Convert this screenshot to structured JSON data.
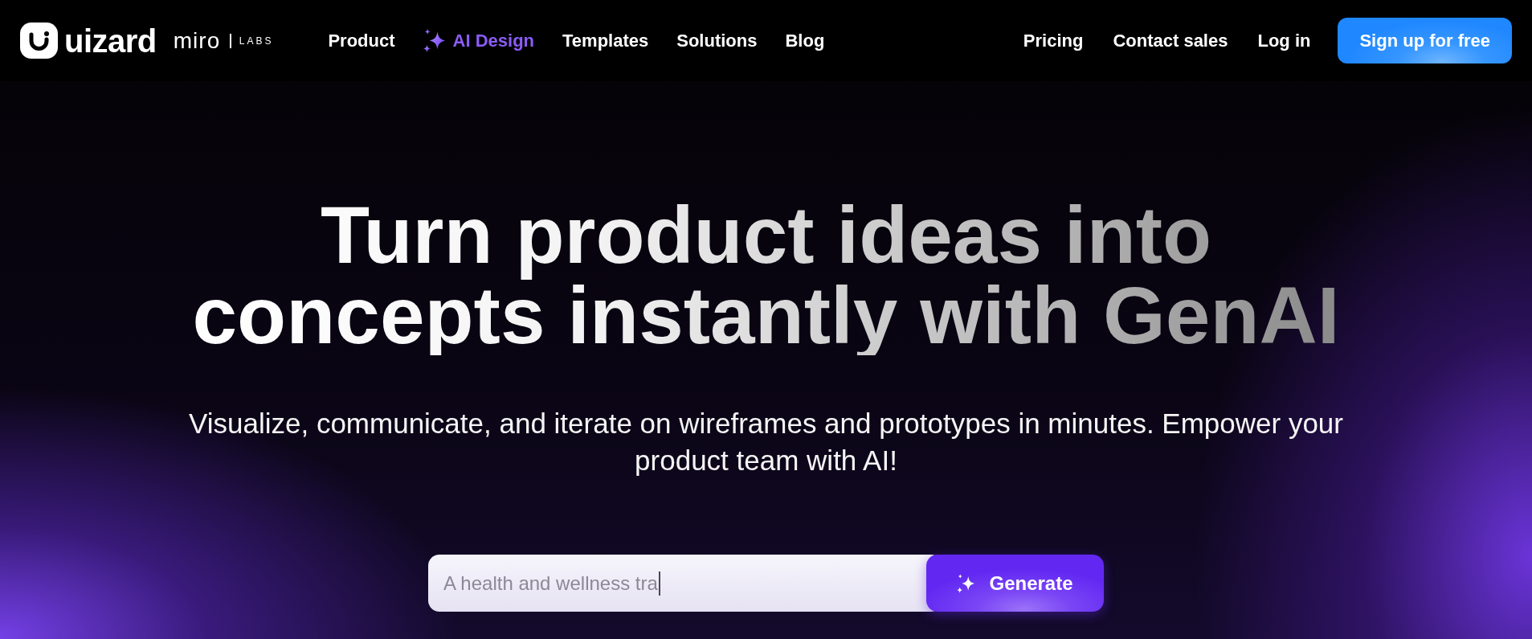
{
  "nav": {
    "logo": {
      "brand": "uizard",
      "partner": "miro",
      "partner_tag": "LABS"
    },
    "links": [
      {
        "label": "Product",
        "kind": "plain"
      },
      {
        "label": "AI Design",
        "kind": "highlight"
      },
      {
        "label": "Templates",
        "kind": "plain"
      },
      {
        "label": "Solutions",
        "kind": "plain"
      },
      {
        "label": "Blog",
        "kind": "plain"
      }
    ],
    "actions": [
      {
        "label": "Pricing",
        "kind": "link"
      },
      {
        "label": "Contact sales",
        "kind": "link"
      },
      {
        "label": "Log in",
        "kind": "link"
      },
      {
        "label": "Sign up for free",
        "kind": "button"
      }
    ]
  },
  "hero": {
    "title_lines": [
      "Turn product ideas into",
      "concepts instantly with GenAI"
    ],
    "subtitle": "Visualize, communicate, and iterate on wireframes and prototypes in minutes. Empower your product team with AI!",
    "prompt": {
      "value": "A health and wellness tra",
      "focused": true,
      "button": "Generate"
    }
  }
}
